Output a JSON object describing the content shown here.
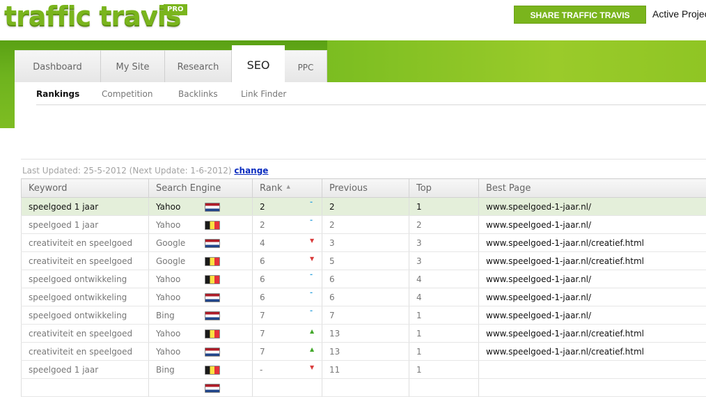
{
  "app": {
    "logo_text": "traffic travis",
    "pro_badge": "PRO",
    "share_button": "SHARE TRAFFIC TRAVIS",
    "active_project_label": "Active Project"
  },
  "nav": {
    "tabs": [
      {
        "label": "Dashboard",
        "active": false
      },
      {
        "label": "My Site",
        "active": false
      },
      {
        "label": "Research",
        "active": false
      },
      {
        "label": "SEO",
        "active": true
      },
      {
        "label": "PPC",
        "active": false
      }
    ],
    "subtabs": [
      {
        "label": "Rankings",
        "active": true
      },
      {
        "label": "Competition",
        "active": false
      },
      {
        "label": "Backlinks",
        "active": false
      },
      {
        "label": "Link Finder",
        "active": false
      }
    ]
  },
  "status": {
    "last_updated_text": "Last Updated: 25-5-2012 (Next Update: 1-6-2012)",
    "change_link": "change"
  },
  "table": {
    "columns": [
      "Keyword",
      "Search Engine",
      "Rank",
      "Previous",
      "Top",
      "Best Page"
    ],
    "rows": [
      {
        "keyword": "speelgoed 1 jaar",
        "engine": "Yahoo",
        "flag": "nl",
        "rank": "2",
        "trend": "same",
        "previous": "2",
        "top": "1",
        "best_page": "www.speelgoed-1-jaar.nl/"
      },
      {
        "keyword": "speelgoed 1 jaar",
        "engine": "Yahoo",
        "flag": "be",
        "rank": "2",
        "trend": "same",
        "previous": "2",
        "top": "2",
        "best_page": "www.speelgoed-1-jaar.nl/"
      },
      {
        "keyword": "creativiteit en speelgoed",
        "engine": "Google",
        "flag": "nl",
        "rank": "4",
        "trend": "down",
        "previous": "3",
        "top": "3",
        "best_page": "www.speelgoed-1-jaar.nl/creatief.html"
      },
      {
        "keyword": "creativiteit en speelgoed",
        "engine": "Google",
        "flag": "be",
        "rank": "6",
        "trend": "down",
        "previous": "5",
        "top": "3",
        "best_page": "www.speelgoed-1-jaar.nl/creatief.html"
      },
      {
        "keyword": "speelgoed ontwikkeling",
        "engine": "Yahoo",
        "flag": "be",
        "rank": "6",
        "trend": "same",
        "previous": "6",
        "top": "4",
        "best_page": "www.speelgoed-1-jaar.nl/"
      },
      {
        "keyword": "speelgoed ontwikkeling",
        "engine": "Yahoo",
        "flag": "nl",
        "rank": "6",
        "trend": "same",
        "previous": "6",
        "top": "4",
        "best_page": "www.speelgoed-1-jaar.nl/"
      },
      {
        "keyword": "speelgoed ontwikkeling",
        "engine": "Bing",
        "flag": "nl",
        "rank": "7",
        "trend": "same",
        "previous": "7",
        "top": "1",
        "best_page": "www.speelgoed-1-jaar.nl/"
      },
      {
        "keyword": "creativiteit en speelgoed",
        "engine": "Yahoo",
        "flag": "be",
        "rank": "7",
        "trend": "up",
        "previous": "13",
        "top": "1",
        "best_page": "www.speelgoed-1-jaar.nl/creatief.html"
      },
      {
        "keyword": "creativiteit en speelgoed",
        "engine": "Yahoo",
        "flag": "nl",
        "rank": "7",
        "trend": "up",
        "previous": "13",
        "top": "1",
        "best_page": "www.speelgoed-1-jaar.nl/creatief.html"
      },
      {
        "keyword": "speelgoed 1 jaar",
        "engine": "Bing",
        "flag": "be",
        "rank": "-",
        "trend": "down",
        "previous": "11",
        "top": "1",
        "best_page": ""
      },
      {
        "keyword": "",
        "engine": "",
        "flag": "nl",
        "rank": "",
        "trend": "",
        "previous": "",
        "top": "",
        "best_page": ""
      }
    ]
  },
  "colors": {
    "brand_green": "#7ab51d",
    "link_blue": "#0b2dbf",
    "selected_row": "#e4efda",
    "trend_same": "#3aa7de",
    "trend_down": "#d93c3c",
    "trend_up": "#43a82b"
  },
  "icons": {
    "trend_same": "dash-icon",
    "trend_down": "triangle-down-icon",
    "trend_up": "triangle-up-icon",
    "sort": "sort-ascending-icon"
  }
}
